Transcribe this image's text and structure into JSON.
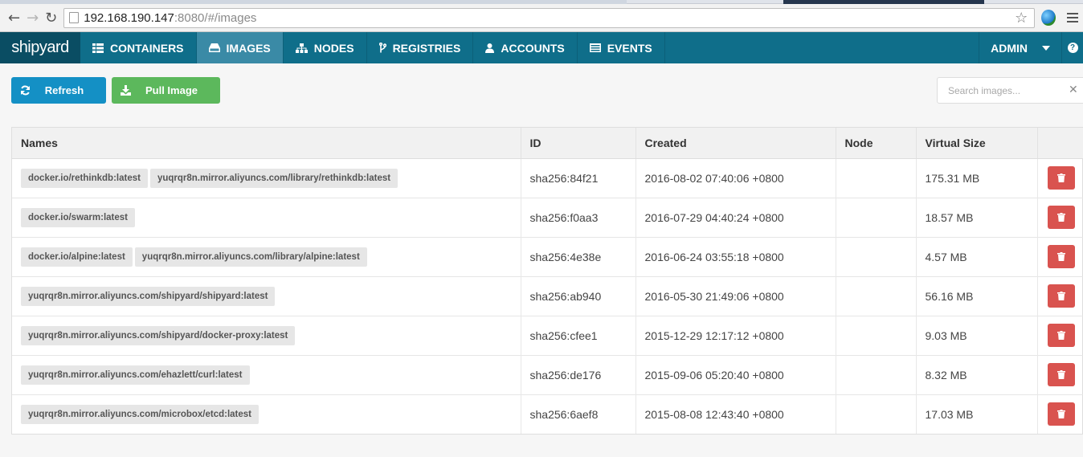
{
  "browser": {
    "url_host": "192.168.190.147",
    "url_path": ":8080/#/images"
  },
  "app": {
    "brand": "shipyard",
    "nav": [
      {
        "label": "CONTAINERS",
        "icon": "grid-icon"
      },
      {
        "label": "IMAGES",
        "icon": "hdd-icon"
      },
      {
        "label": "NODES",
        "icon": "sitemap-icon"
      },
      {
        "label": "REGISTRIES",
        "icon": "branch-icon"
      },
      {
        "label": "ACCOUNTS",
        "icon": "user-icon"
      },
      {
        "label": "EVENTS",
        "icon": "list-icon"
      }
    ],
    "active_nav": "IMAGES",
    "user_menu": "ADMIN"
  },
  "toolbar": {
    "refresh_label": "Refresh",
    "pull_label": "Pull Image",
    "search_placeholder": "Search images...",
    "search_value": "",
    "accent_blue": "#1490c5",
    "accent_green": "#5cb85c"
  },
  "table": {
    "headers": [
      "Names",
      "ID",
      "Created",
      "Node",
      "Virtual Size",
      ""
    ],
    "rows": [
      {
        "names": [
          "docker.io/rethinkdb:latest",
          "yuqrqr8n.mirror.aliyuncs.com/library/rethinkdb:latest"
        ],
        "id": "sha256:84f21",
        "created": "2016-08-02 07:40:06 +0800",
        "node": "",
        "size": "175.31 MB"
      },
      {
        "names": [
          "docker.io/swarm:latest"
        ],
        "id": "sha256:f0aa3",
        "created": "2016-07-29 04:40:24 +0800",
        "node": "",
        "size": "18.57 MB"
      },
      {
        "names": [
          "docker.io/alpine:latest",
          "yuqrqr8n.mirror.aliyuncs.com/library/alpine:latest"
        ],
        "id": "sha256:4e38e",
        "created": "2016-06-24 03:55:18 +0800",
        "node": "",
        "size": "4.57 MB"
      },
      {
        "names": [
          "yuqrqr8n.mirror.aliyuncs.com/shipyard/shipyard:latest"
        ],
        "id": "sha256:ab940",
        "created": "2016-05-30 21:49:06 +0800",
        "node": "",
        "size": "56.16 MB"
      },
      {
        "names": [
          "yuqrqr8n.mirror.aliyuncs.com/shipyard/docker-proxy:latest"
        ],
        "id": "sha256:cfee1",
        "created": "2015-12-29 12:17:12 +0800",
        "node": "",
        "size": "9.03 MB"
      },
      {
        "names": [
          "yuqrqr8n.mirror.aliyuncs.com/ehazlett/curl:latest"
        ],
        "id": "sha256:de176",
        "created": "2015-09-06 05:20:40 +0800",
        "node": "",
        "size": "8.32 MB"
      },
      {
        "names": [
          "yuqrqr8n.mirror.aliyuncs.com/microbox/etcd:latest"
        ],
        "id": "sha256:6aef8",
        "created": "2015-08-08 12:43:40 +0800",
        "node": "",
        "size": "17.03 MB"
      }
    ],
    "delete_icon": "trash-icon",
    "delete_color": "#d9534f"
  }
}
